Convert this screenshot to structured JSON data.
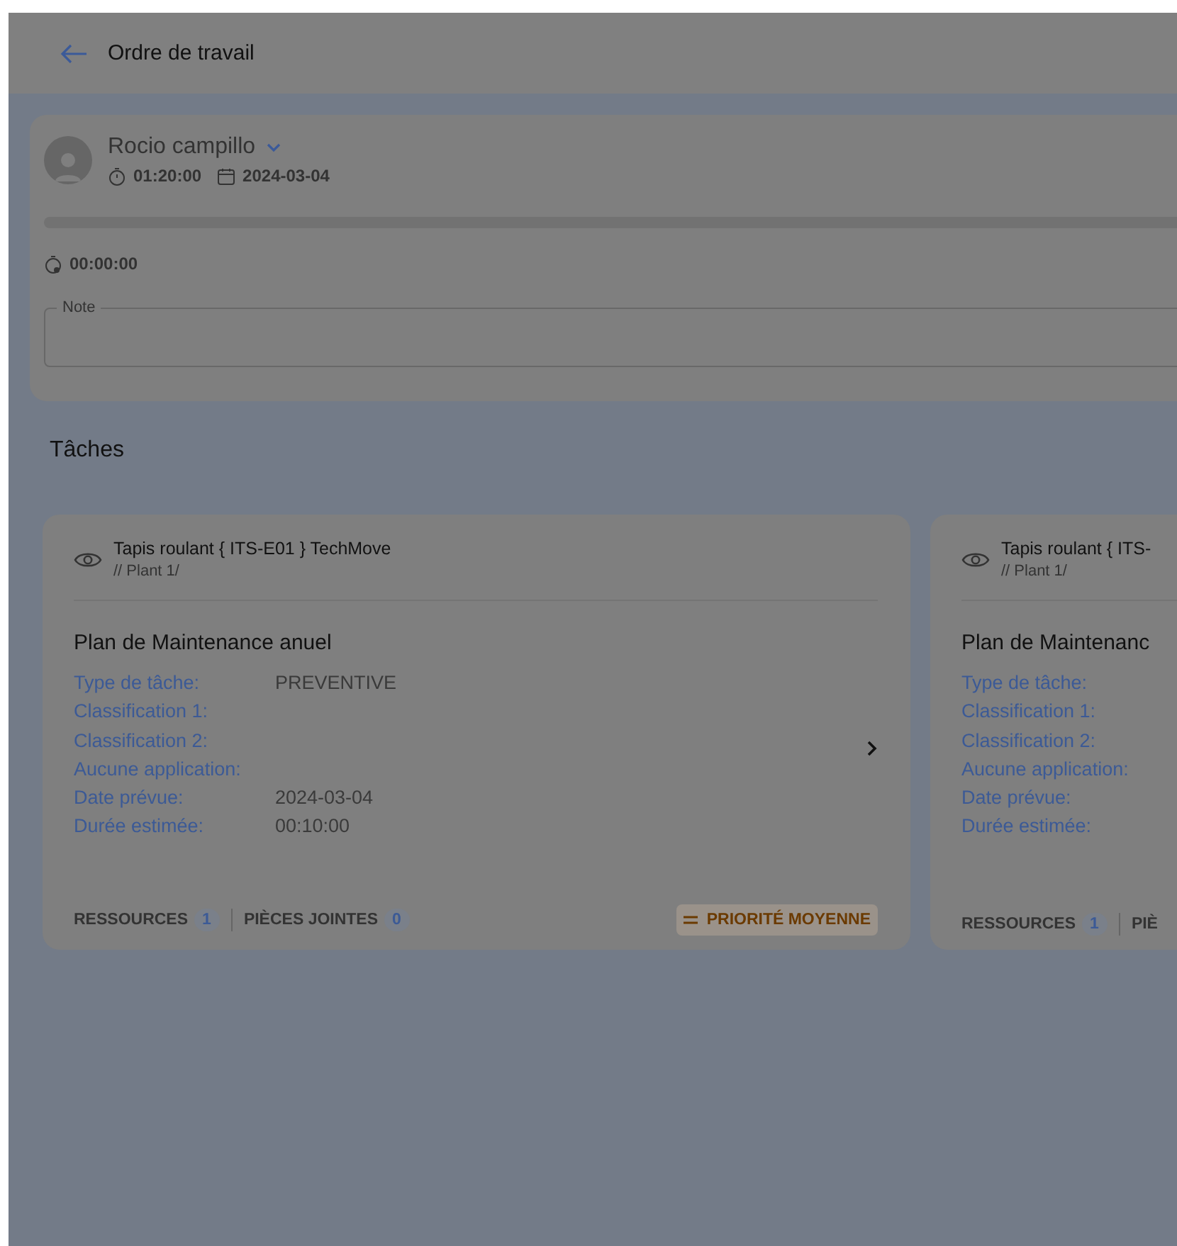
{
  "header": {
    "title": "Ordre de travail"
  },
  "worker": {
    "name": "Rocio campillo",
    "duration": "01:20:00",
    "date": "2024-03-04",
    "timer": "00:00:00",
    "note": {
      "label": "Note"
    }
  },
  "section_title": "Tâches",
  "tasks": [
    {
      "asset": "Tapis roulant { ITS-E01 } TechMove",
      "location": "// Plant 1/",
      "plan": "Plan de Maintenance anuel",
      "fields": [
        {
          "label": "Type de tâche:",
          "value": "PREVENTIVE"
        },
        {
          "label": "Classification 1:"
        },
        {
          "label": "Classification 2:"
        },
        {
          "label": "Aucune application:"
        },
        {
          "label": "Date prévue:",
          "value": "2024-03-04"
        },
        {
          "label": "Durée estimée:",
          "value": "00:10:00"
        }
      ],
      "resources_label": "RESSOURCES",
      "resources_count": "1",
      "attachments_label": "PIÈCES JOINTES",
      "attachments_count": "0",
      "priority": "PRIORITÉ MOYENNE"
    },
    {
      "asset": "Tapis roulant { ITS-",
      "location": "// Plant 1/",
      "plan": "Plan de Maintenanc",
      "fields": [
        {
          "label": "Type de tâche:"
        },
        {
          "label": "Classification 1:"
        },
        {
          "label": "Classification 2:"
        },
        {
          "label": "Aucune application:"
        },
        {
          "label": "Date prévue:"
        },
        {
          "label": "Durée estimée:"
        }
      ],
      "resources_label": "RESSOURCES",
      "resources_count": "1",
      "attachments_label": "PIÈ"
    }
  ]
}
